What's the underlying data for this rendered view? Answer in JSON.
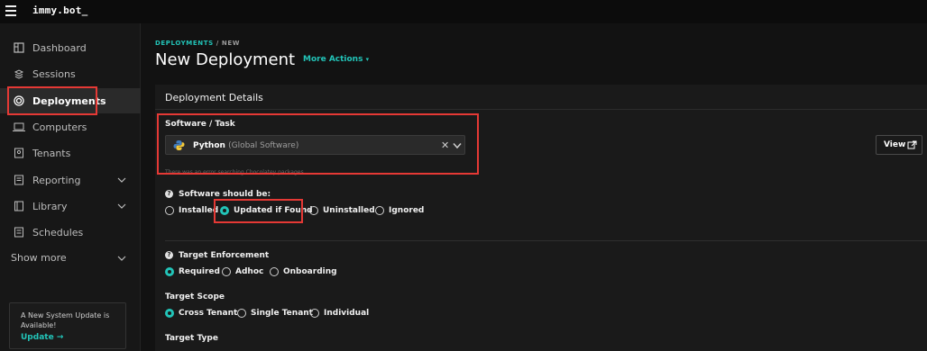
{
  "brand": "immy.bot_",
  "sidebar": {
    "items": [
      {
        "label": "Dashboard",
        "icon": "dashboard-icon"
      },
      {
        "label": "Sessions",
        "icon": "sessions-icon"
      },
      {
        "label": "Deployments",
        "icon": "deployments-icon",
        "active": true
      },
      {
        "label": "Computers",
        "icon": "laptop-icon"
      },
      {
        "label": "Tenants",
        "icon": "tenants-icon"
      },
      {
        "label": "Reporting",
        "icon": "reporting-icon",
        "expandable": true
      },
      {
        "label": "Library",
        "icon": "library-icon",
        "expandable": true
      },
      {
        "label": "Schedules",
        "icon": "schedules-icon"
      }
    ],
    "show_more": "Show more",
    "update_card": {
      "message": "A New System Update is Available!",
      "link": "Update"
    }
  },
  "breadcrumb": {
    "parent": "DEPLOYMENTS",
    "separator": "/",
    "current": "NEW"
  },
  "page_title": "New Deployment",
  "more_actions": "More Actions",
  "panel": {
    "title": "Deployment Details",
    "software_label": "Software / Task",
    "software_value": "Python",
    "software_sub": "(Global Software)",
    "hint": "There was an error searching Chocolatey packages",
    "view_button": "View",
    "should_be_label": "Software should be:",
    "should_be_options": [
      "Installed",
      "Updated if Found",
      "Uninstalled",
      "Ignored"
    ],
    "should_be_selected": "Updated if Found",
    "enforcement_label": "Target Enforcement",
    "enforcement_options": [
      "Required",
      "Adhoc",
      "Onboarding"
    ],
    "enforcement_selected": "Required",
    "scope_label": "Target Scope",
    "scope_options": [
      "Cross Tenant",
      "Single Tenant",
      "Individual"
    ],
    "scope_selected": "Cross Tenant",
    "type_label": "Target Type"
  },
  "colors": {
    "accent": "#22c4b8",
    "highlight": "#e53935",
    "background": "#121212"
  }
}
